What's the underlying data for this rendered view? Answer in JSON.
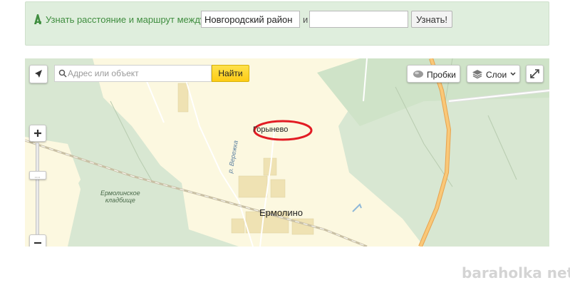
{
  "route": {
    "label": "Узнать расстояние и маршрут между",
    "from_value": "Новгородский район",
    "and_text": "и",
    "to_value": "",
    "submit_label": "Узнать!"
  },
  "map": {
    "search_placeholder": "Адрес или объект",
    "search_button": "Найти",
    "traffic_label": "Пробки",
    "layers_label": "Слои",
    "places": {
      "village_north": "Горынево",
      "village_main": "Ермолино",
      "cemetery_line1": "Ермолинское",
      "cemetery_line2": "кладбище",
      "river": "р. Вережка"
    },
    "colors": {
      "forest": "#d8e7d2",
      "settlement": "#fcf8e0",
      "highway": "#f6b964",
      "highlight_ellipse": "#e21c24"
    }
  },
  "watermark": "baraholka net"
}
